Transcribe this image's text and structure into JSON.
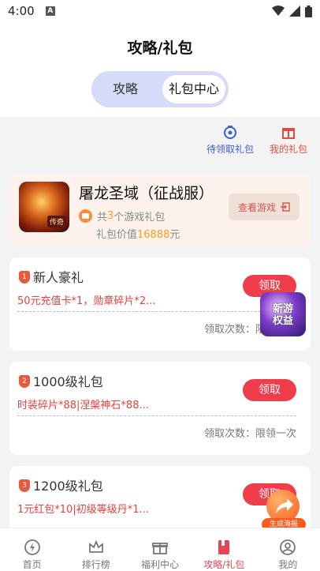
{
  "status_bar": {
    "time": "4:00",
    "notif_letter": "A"
  },
  "header": {
    "title": "攻略/礼包"
  },
  "segment": {
    "tabs": [
      "攻略",
      "礼包中心"
    ],
    "selected_index": 1
  },
  "quick_links": [
    {
      "label": "待领取礼包",
      "icon": "gift-box-icon",
      "color": "#3f5fd6"
    },
    {
      "label": "我的礼包",
      "icon": "gift-icon",
      "color": "#e34d3c"
    }
  ],
  "game": {
    "name": "屠龙圣域（征战服）",
    "logo_badge": "传奇",
    "gift_prefix": "共",
    "gift_count": "3",
    "gift_suffix": "个游戏礼包",
    "value_prefix": "礼包价值",
    "value_amount": "16888",
    "value_suffix": "元",
    "view_button": "查看游戏"
  },
  "packs": [
    {
      "num": "1",
      "title": "新人豪礼",
      "claim": "领取",
      "rewards": "50元充值卡*1，勋章碎片*2...",
      "times": "领取次数：限领一次"
    },
    {
      "num": "2",
      "title": "1000级礼包",
      "claim": "领取",
      "rewards": "时装碎片*88|涅槃神石*88...",
      "times": "领取次数：限领一次"
    },
    {
      "num": "3",
      "title": "1200级礼包",
      "claim": "领取",
      "rewards": "1元红包*10|初级等级丹*1...",
      "times": ""
    }
  ],
  "floating": {
    "new_game": "新游权益",
    "new_game_l1": "新游",
    "new_game_l2": "权益",
    "poster": "生成海报"
  },
  "nav": [
    {
      "label": "首页",
      "icon": "home-icon",
      "active": false
    },
    {
      "label": "排行榜",
      "icon": "crown-icon",
      "active": false
    },
    {
      "label": "福利中心",
      "icon": "gift-icon",
      "active": false
    },
    {
      "label": "攻略/礼包",
      "icon": "book-icon",
      "active": true
    },
    {
      "label": "我的",
      "icon": "profile-icon",
      "active": false
    }
  ],
  "colors": {
    "accent": "#ef3d4b",
    "segment_bg": "#d5dbf8",
    "content_bg": "#f3f3f3",
    "reward_text": "#e5423a",
    "highlight": "#ff9a1a"
  }
}
